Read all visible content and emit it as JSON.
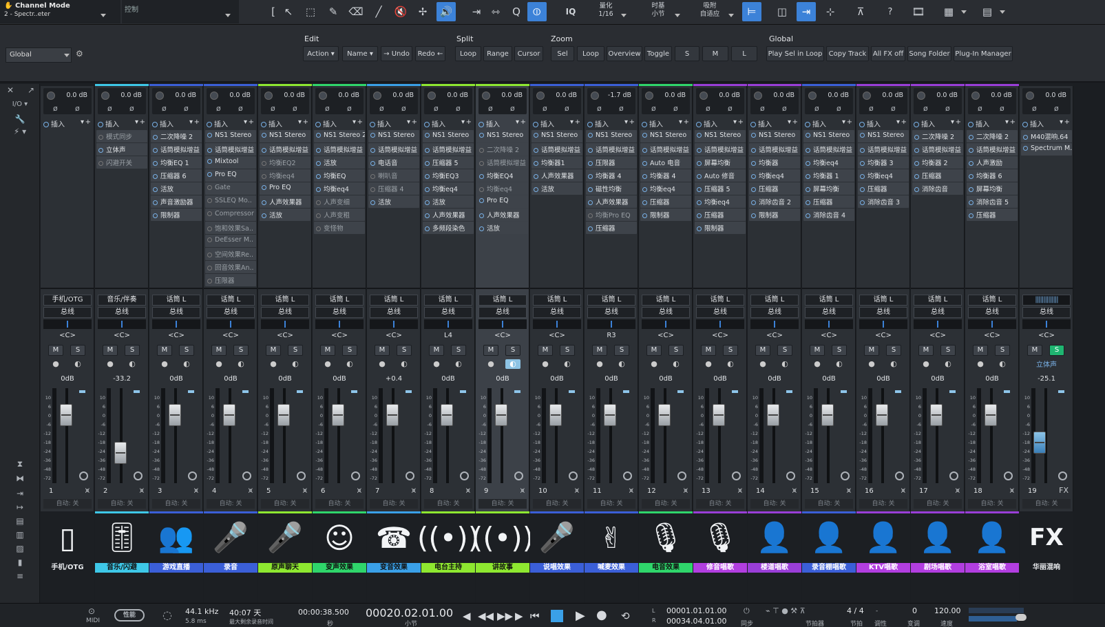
{
  "topbar": {
    "channel_mode_title": "Channel Mode",
    "channel_mode_value": "2 - Spectr..eter",
    "control_label": "控制",
    "tools": [
      "[",
      "↖",
      "⬚",
      "✎",
      "⌫",
      "╱",
      "🔇",
      "✢",
      "🔊",
      "⇥",
      "⇿",
      "Q",
      "⦶"
    ],
    "iq_label": "IQ",
    "quantize_label": "量化",
    "quantize_value": "1/16",
    "timebase_label": "时基",
    "timebase_value": "小节",
    "snap_label": "吸附",
    "snap_value": "自适应",
    "help_label": "?"
  },
  "bar2": {
    "global_select": "Global",
    "sections": {
      "edit": "Edit",
      "split": "Split",
      "zoom": "Zoom",
      "global": "Global"
    },
    "edit_buttons": [
      "Action",
      "Name",
      "Undo",
      "Redo"
    ],
    "split_buttons": [
      "Loop",
      "Range",
      "Cursor"
    ],
    "zoom_buttons": [
      "Sel",
      "Loop",
      "Overview",
      "Toggle",
      "S",
      "M",
      "L"
    ],
    "global_buttons": [
      "Play Sel in Loop",
      "Copy Track",
      "All FX off",
      "Song Folder",
      "Plug-In Manager"
    ]
  },
  "leftstrip": {
    "io_label": "I/O"
  },
  "insert_header": "插入",
  "auto_label": "自动: 关",
  "channels": [
    {
      "num": "1",
      "gain": "0.0 dB",
      "inserts": [],
      "input": "手机/OTG",
      "output": "总线",
      "pan": "<C>",
      "vol": "0dB",
      "label": "手机/OTG",
      "icon": "phone-icon",
      "color": "#1c1f23",
      "label_bg": "#1c1f23",
      "label_fg": "#e6e8eb"
    },
    {
      "num": "2",
      "gain": "0.0 dB",
      "inserts": [
        {
          "n": "模式同步",
          "on": false
        },
        {
          "n": "立体声",
          "on": true
        },
        {
          "n": "闪避开关",
          "on": false
        }
      ],
      "input": "音乐/伴奏",
      "output": "总线",
      "pan": "<C>",
      "vol": "-33.2",
      "label": "音乐/闪避",
      "icon": "mixer-icon",
      "color": "#3ec8e8",
      "label_bg": "#3ec8e8",
      "label_fg": "#111"
    },
    {
      "num": "3",
      "gain": "0.0 dB",
      "inserts": [
        {
          "n": "二次降噪 2",
          "on": true
        },
        {
          "n": "话筒模拟增益",
          "on": true
        },
        {
          "n": "均衡EQ 1",
          "on": true
        },
        {
          "n": "压缩器 6",
          "on": true
        },
        {
          "n": "活放",
          "on": true
        },
        {
          "n": "声音激励器",
          "on": true
        },
        {
          "n": "限制器",
          "on": true
        }
      ],
      "input": "话筒 L",
      "output": "总线",
      "pan": "<C>",
      "vol": "0dB",
      "label": "游戏直播",
      "icon": "group-icon",
      "color": "#3b5fd8",
      "label_bg": "#3b5fd8",
      "label_fg": "#fff"
    },
    {
      "num": "4",
      "gain": "0.0 dB",
      "inserts": [
        {
          "n": "NS1 Stereo",
          "on": true
        },
        {
          "n": "话筒模拟增益",
          "on": true
        },
        {
          "n": "Mixtool",
          "on": true
        },
        {
          "n": "Pro EQ",
          "on": true
        },
        {
          "n": "Gate",
          "on": false
        },
        {
          "n": "SSLEQ Mo..",
          "on": false
        },
        {
          "n": "Compressor",
          "on": false
        },
        {
          "n": "饱和效果Sa..",
          "on": false
        },
        {
          "n": "DeEsser M..",
          "on": false
        },
        {
          "n": "空间效果Re..",
          "on": false
        },
        {
          "n": "回音效果An..",
          "on": false
        },
        {
          "n": "压限器",
          "on": false
        }
      ],
      "input": "话筒 L",
      "output": "总线",
      "pan": "<C>",
      "vol": "0dB",
      "label": "录音",
      "icon": "mic-icon",
      "color": "#3b5fd8",
      "label_bg": "#3b5fd8",
      "label_fg": "#fff"
    },
    {
      "num": "5",
      "gain": "0.0 dB",
      "inserts": [
        {
          "n": "NS1 Stereo",
          "on": true
        },
        {
          "n": "话筒模拟增益",
          "on": true
        },
        {
          "n": "均衡EQ2",
          "on": false
        },
        {
          "n": "均衡eq4",
          "on": false
        },
        {
          "n": "Pro EQ",
          "on": true
        },
        {
          "n": "人声效果器",
          "on": true
        },
        {
          "n": "活放",
          "on": true
        }
      ],
      "input": "话筒 L",
      "output": "总线",
      "pan": "<C>",
      "vol": "0dB",
      "label": "原声聊天",
      "icon": "mic-icon",
      "color": "#8ee830",
      "label_bg": "#8ee830",
      "label_fg": "#111"
    },
    {
      "num": "6",
      "gain": "0.0 dB",
      "inserts": [
        {
          "n": "NS1 Stereo 2",
          "on": true
        },
        {
          "n": "话筒模拟增益",
          "on": true
        },
        {
          "n": "活放",
          "on": true
        },
        {
          "n": "均衡EQ",
          "on": true
        },
        {
          "n": "均衡eq4",
          "on": true
        },
        {
          "n": "人声变细",
          "on": false
        },
        {
          "n": "人声变粗",
          "on": false
        },
        {
          "n": "变怪物",
          "on": false
        }
      ],
      "input": "话筒 L",
      "output": "总线",
      "pan": "<C>",
      "vol": "0dB",
      "label": "变声效果",
      "icon": "smile-icon",
      "color": "#2fd66b",
      "label_bg": "#2fd66b",
      "label_fg": "#111"
    },
    {
      "num": "7",
      "gain": "0.0 dB",
      "inserts": [
        {
          "n": "NS1 Stereo",
          "on": true
        },
        {
          "n": "话筒模拟增益",
          "on": true
        },
        {
          "n": "电话音",
          "on": true
        },
        {
          "n": "喇叭音",
          "on": false
        },
        {
          "n": "压缩器 4",
          "on": false
        },
        {
          "n": "活放",
          "on": true
        }
      ],
      "input": "话筒 L",
      "output": "总线",
      "pan": "<C>",
      "vol": "+0.4",
      "label": "变音效果",
      "icon": "telephone-icon",
      "color": "#3aa0e8",
      "label_bg": "#3aa0e8",
      "label_fg": "#111"
    },
    {
      "num": "8",
      "gain": "0.0 dB",
      "inserts": [
        {
          "n": "NS1 Stereo",
          "on": true
        },
        {
          "n": "话筒模拟增益",
          "on": true
        },
        {
          "n": "压缩器 5",
          "on": true
        },
        {
          "n": "均衡EQ3",
          "on": true
        },
        {
          "n": "均衡eq4",
          "on": true
        },
        {
          "n": "活放",
          "on": true
        },
        {
          "n": "人声效果器",
          "on": true
        },
        {
          "n": "多频段染色",
          "on": true
        }
      ],
      "input": "话筒 L",
      "output": "总线",
      "pan": "L4",
      "vol": "0dB",
      "label": "电台主持",
      "icon": "broadcast-icon",
      "color": "#8ee830",
      "label_bg": "#8ee830",
      "label_fg": "#111"
    },
    {
      "num": "9",
      "gain": "0.0 dB",
      "inserts": [
        {
          "n": "NS1 Stereo",
          "on": true
        },
        {
          "n": "二次降噪 2",
          "on": false
        },
        {
          "n": "话筒模拟增益",
          "on": false
        },
        {
          "n": "均衡EQ4",
          "on": true
        },
        {
          "n": "均衡eq4",
          "on": false
        },
        {
          "n": "Pro EQ",
          "on": true
        },
        {
          "n": "人声效果器",
          "on": true
        },
        {
          "n": "活放",
          "on": true
        }
      ],
      "input": "话筒 L",
      "output": "总线",
      "pan": "<C>",
      "vol": "0dB",
      "label": "讲故事",
      "icon": "broadcast-icon",
      "color": "#8ee830",
      "label_bg": "#8ee830",
      "label_fg": "#111",
      "selected": true
    },
    {
      "num": "10",
      "gain": "0.0 dB",
      "inserts": [
        {
          "n": "NS1 Stereo",
          "on": true
        },
        {
          "n": "话筒模拟增益",
          "on": true
        },
        {
          "n": "均衡器1",
          "on": true
        },
        {
          "n": "人声效果器",
          "on": true
        },
        {
          "n": "活放",
          "on": true
        }
      ],
      "input": "话筒 L",
      "output": "总线",
      "pan": "<C>",
      "vol": "0dB",
      "label": "说唱效果",
      "icon": "mic-icon",
      "color": "#3b5fd8",
      "label_bg": "#3b5fd8",
      "label_fg": "#fff"
    },
    {
      "num": "11",
      "gain": "-1.7 dB",
      "inserts": [
        {
          "n": "NS1 Stereo",
          "on": true
        },
        {
          "n": "话筒模拟增益",
          "on": true
        },
        {
          "n": "压限器",
          "on": true
        },
        {
          "n": "均衡器 4",
          "on": true
        },
        {
          "n": "磁性均衡",
          "on": true
        },
        {
          "n": "人声效果器",
          "on": true
        },
        {
          "n": "均衡Pro EQ",
          "on": false
        },
        {
          "n": "压缩器",
          "on": true
        }
      ],
      "input": "话筒 L",
      "output": "总线",
      "pan": "R3",
      "vol": "0dB",
      "label": "喊麦效果",
      "icon": "rock-hand-icon",
      "color": "#3b5fd8",
      "label_bg": "#3b5fd8",
      "label_fg": "#fff"
    },
    {
      "num": "12",
      "gain": "0.0 dB",
      "inserts": [
        {
          "n": "NS1 Stereo",
          "on": true
        },
        {
          "n": "话筒模拟增益",
          "on": true
        },
        {
          "n": "Auto 电音",
          "on": true
        },
        {
          "n": "均衡器 4",
          "on": true
        },
        {
          "n": "均衡eq4",
          "on": true
        },
        {
          "n": "压缩器",
          "on": true
        },
        {
          "n": "限制器",
          "on": true
        }
      ],
      "input": "话筒 L",
      "output": "总线",
      "pan": "<C>",
      "vol": "0dB",
      "label": "电音效果",
      "icon": "mic-wave-icon",
      "color": "#2fd66b",
      "label_bg": "#2fd66b",
      "label_fg": "#111"
    },
    {
      "num": "13",
      "gain": "0.0 dB",
      "inserts": [
        {
          "n": "NS1 Stereo",
          "on": true
        },
        {
          "n": "话筒模拟增益",
          "on": true
        },
        {
          "n": "屏幕均衡",
          "on": true
        },
        {
          "n": "Auto 修音",
          "on": true
        },
        {
          "n": "压缩器 5",
          "on": true
        },
        {
          "n": "均衡eq4",
          "on": true
        },
        {
          "n": "压缩器",
          "on": true
        },
        {
          "n": "限制器",
          "on": true
        }
      ],
      "input": "话筒 L",
      "output": "总线",
      "pan": "<C>",
      "vol": "0dB",
      "label": "修音唱歌",
      "icon": "mic-wave-icon",
      "color": "#9a3ed8",
      "label_bg": "#b23ee0",
      "label_fg": "#fff"
    },
    {
      "num": "14",
      "gain": "0.0 dB",
      "inserts": [
        {
          "n": "NS1 Stereo",
          "on": true
        },
        {
          "n": "话筒模拟增益",
          "on": true
        },
        {
          "n": "均衡器",
          "on": true
        },
        {
          "n": "均衡eq4",
          "on": true
        },
        {
          "n": "压缩器",
          "on": true
        },
        {
          "n": "消除齿音 2",
          "on": true
        },
        {
          "n": "限制器",
          "on": true
        }
      ],
      "input": "话筒 L",
      "output": "总线",
      "pan": "<C>",
      "vol": "0dB",
      "label": "楼道唱歌",
      "icon": "singer-icon",
      "color": "#9a3ed8",
      "label_bg": "#9a3ed8",
      "label_fg": "#fff"
    },
    {
      "num": "15",
      "gain": "0.0 dB",
      "inserts": [
        {
          "n": "NS1 Stereo",
          "on": true
        },
        {
          "n": "话筒模拟增益",
          "on": true
        },
        {
          "n": "均衡eq4",
          "on": true
        },
        {
          "n": "均衡器 1",
          "on": true
        },
        {
          "n": "屏幕均衡",
          "on": true
        },
        {
          "n": "压缩器",
          "on": true
        },
        {
          "n": "消除齿音 4",
          "on": true
        }
      ],
      "input": "话筒 L",
      "output": "总线",
      "pan": "<C>",
      "vol": "0dB",
      "label": "录音棚唱歌",
      "icon": "singer-icon",
      "color": "#3b5fd8",
      "label_bg": "#3b5fd8",
      "label_fg": "#fff"
    },
    {
      "num": "16",
      "gain": "0.0 dB",
      "inserts": [
        {
          "n": "NS1 Stereo",
          "on": true
        },
        {
          "n": "话筒模拟增益",
          "on": true
        },
        {
          "n": "均衡器 3",
          "on": true
        },
        {
          "n": "均衡eq4",
          "on": true
        },
        {
          "n": "压缩器",
          "on": true
        },
        {
          "n": "消除齿音 3",
          "on": true
        }
      ],
      "input": "话筒 L",
      "output": "总线",
      "pan": "<C>",
      "vol": "0dB",
      "label": "KTV唱歌",
      "icon": "singer-icon",
      "color": "#9a3ed8",
      "label_bg": "#b23ee0",
      "label_fg": "#fff"
    },
    {
      "num": "17",
      "gain": "0.0 dB",
      "inserts": [
        {
          "n": "二次降噪 2",
          "on": true
        },
        {
          "n": "话筒模拟增益",
          "on": true
        },
        {
          "n": "均衡器 2",
          "on": true
        },
        {
          "n": "压缩器",
          "on": true
        },
        {
          "n": "消除齿音",
          "on": true
        }
      ],
      "input": "话筒 L",
      "output": "总线",
      "pan": "<C>",
      "vol": "0dB",
      "label": "剧场唱歌",
      "icon": "singer-icon",
      "color": "#9a3ed8",
      "label_bg": "#b23ee0",
      "label_fg": "#fff"
    },
    {
      "num": "18",
      "gain": "0.0 dB",
      "inserts": [
        {
          "n": "二次降噪 2",
          "on": true
        },
        {
          "n": "话筒模拟增益",
          "on": true
        },
        {
          "n": "人声激励",
          "on": true
        },
        {
          "n": "均衡器 6",
          "on": true
        },
        {
          "n": "屏幕均衡",
          "on": true
        },
        {
          "n": "消除齿音 5",
          "on": true
        },
        {
          "n": "压缩器",
          "on": true
        }
      ],
      "input": "话筒 L",
      "output": "总线",
      "pan": "<C>",
      "vol": "0dB",
      "label": "浴室唱歌",
      "icon": "singer-icon",
      "color": "#9a3ed8",
      "label_bg": "#b23ee0",
      "label_fg": "#fff"
    },
    {
      "num": "19",
      "gain": "0.0 dB",
      "inserts": [
        {
          "n": "M40混响.64",
          "on": true
        },
        {
          "n": "Spectrum M..",
          "on": true
        }
      ],
      "input": "",
      "output": "总线",
      "pan": "<C>",
      "vol": "-25.1",
      "label": "华丽混响",
      "icon": "fx-icon",
      "color": "#1c1f23",
      "label_bg": "#1c1f23",
      "label_fg": "#e6e8eb",
      "fx": true,
      "stereo": "立体声",
      "suffix": "FX"
    }
  ],
  "bottombar": {
    "midi_label": "MIDI",
    "performance_label": "性能",
    "sample_rate": "44.1 kHz",
    "latency": "5.8 ms",
    "record_time": "40:07 天",
    "record_time_label": "最大剩余录音时间",
    "seconds": "00:00:38.500",
    "seconds_label": "秒",
    "position": "00020.02.01.00",
    "position_label": "小节",
    "loop_start": "00001.01.01.00",
    "loop_end": "00034.04.01.00",
    "sync_label": "同步",
    "metronome_label": "节拍器",
    "timesig": "4 / 4",
    "timesig_label": "节拍",
    "key_label": "调性",
    "transpose": "0",
    "transpose_label": "变调",
    "tempo": "120.00",
    "tempo_label": "速度"
  }
}
